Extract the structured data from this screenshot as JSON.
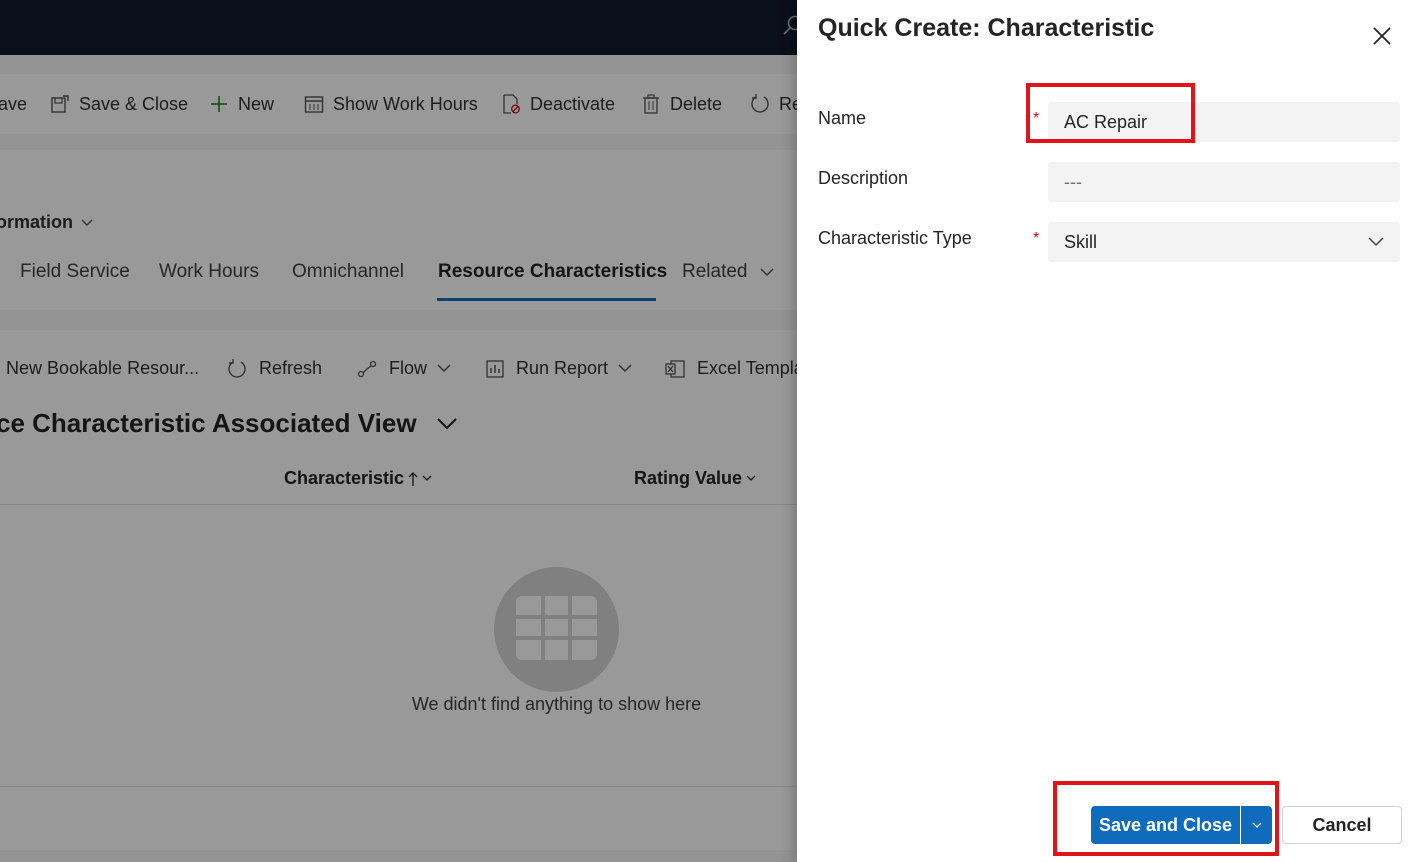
{
  "background": {
    "command_bar": {
      "save_partial": "ave",
      "save_close": "Save & Close",
      "new": "New",
      "show_work_hours": "Show Work Hours",
      "deactivate": "Deactivate",
      "delete": "Delete",
      "refresh_partial": "Re"
    },
    "form_selector": "ormation",
    "tabs": [
      {
        "label": "Field Service",
        "active": false
      },
      {
        "label": "Work Hours",
        "active": false
      },
      {
        "label": "Omnichannel",
        "active": false
      },
      {
        "label": "Resource Characteristics",
        "active": true
      },
      {
        "label": "Related",
        "active": false
      }
    ],
    "subgrid_commands": {
      "new_bookable": "New Bookable Resour...",
      "refresh": "Refresh",
      "flow": "Flow",
      "run_report": "Run Report",
      "excel_templates": "Excel Templa"
    },
    "view_title": "ce Characteristic Associated View",
    "columns": {
      "characteristic": "Characteristic",
      "rating_value": "Rating Value"
    },
    "empty_message": "We didn't find anything to show here"
  },
  "quick_create": {
    "title": "Quick Create: Characteristic",
    "fields": {
      "name": {
        "label": "Name",
        "value": "AC Repair",
        "required": true
      },
      "description": {
        "label": "Description",
        "placeholder": "---",
        "required": false
      },
      "characteristic_type": {
        "label": "Characteristic Type",
        "value": "Skill",
        "required": true
      }
    },
    "required_marker": "*",
    "save_and_close": "Save and Close",
    "cancel": "Cancel"
  },
  "colors": {
    "primary": "#0f6cbd",
    "highlight": "#e0151b",
    "required": "#c50f1f",
    "topbar": "#0f1b2d"
  }
}
